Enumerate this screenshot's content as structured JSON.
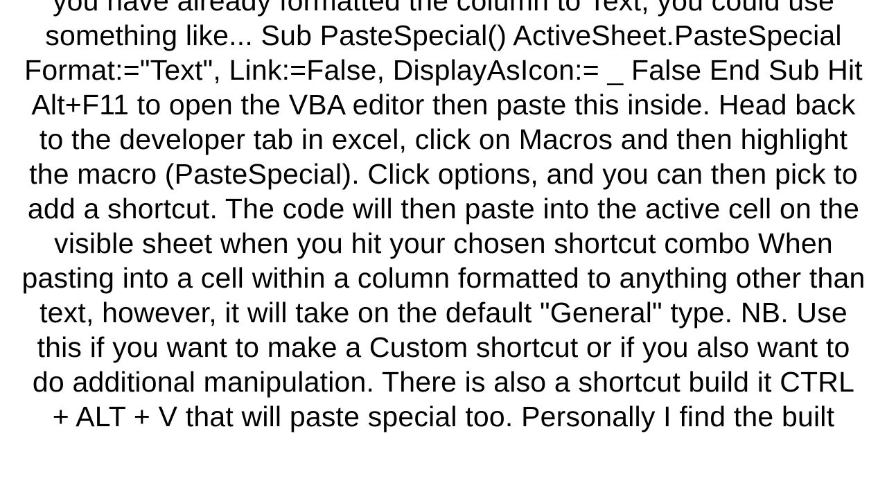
{
  "document": {
    "paragraph": "you have already formatted the column to Text, you could use something like... Sub PasteSpecial()     ActiveSheet.PasteSpecial Format:=\"Text\", Link:=False, DisplayAsIcon:= _         False End Sub  Hit Alt+F11 to open the VBA editor then paste this inside. Head back to the developer tab in excel, click on Macros and then highlight the macro (PasteSpecial). Click options, and you can then pick to add a shortcut. The code will then paste into the active cell on the visible sheet when you hit your chosen shortcut combo When pasting into a cell within a column formatted to anything other than text, however, it will take on the default \"General\" type. NB. Use this if you want to make a Custom shortcut or if you also want to do additional manipulation. There is also a shortcut build it CTRL + ALT + V that will paste special too. Personally I find the built"
  }
}
